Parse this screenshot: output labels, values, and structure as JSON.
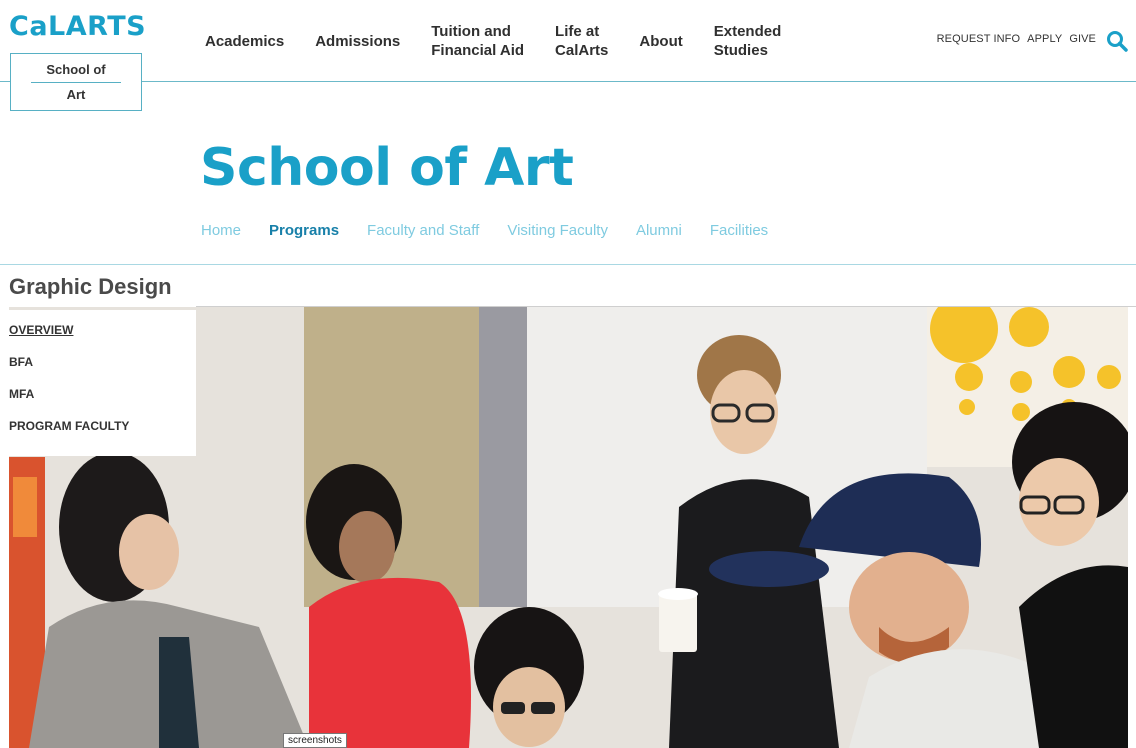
{
  "header": {
    "logo": "CaLARTS",
    "school_badge": {
      "line1": "School of",
      "line2": "Art"
    },
    "main_nav": [
      {
        "label": "Academics"
      },
      {
        "label": "Admissions"
      },
      {
        "label": "Tuition and\nFinancial Aid"
      },
      {
        "label": "Life at\nCalArts"
      },
      {
        "label": "About"
      },
      {
        "label": "Extended\nStudies"
      }
    ],
    "util_nav": [
      {
        "label": "REQUEST INFO"
      },
      {
        "label": "APPLY"
      },
      {
        "label": "GIVE"
      }
    ],
    "search_icon": "search-icon"
  },
  "page": {
    "title": "School of Art",
    "sub_nav": [
      {
        "label": "Home",
        "active": false
      },
      {
        "label": "Programs",
        "active": true
      },
      {
        "label": "Faculty and Staff",
        "active": false
      },
      {
        "label": "Visiting Faculty",
        "active": false
      },
      {
        "label": "Alumni",
        "active": false
      },
      {
        "label": "Facilities",
        "active": false
      }
    ]
  },
  "section": {
    "title": "Graphic Design",
    "menu": [
      {
        "label": "OVERVIEW",
        "current": true
      },
      {
        "label": "BFA",
        "current": false
      },
      {
        "label": "MFA",
        "current": false
      },
      {
        "label": "PROGRAM FACULTY",
        "current": false
      }
    ]
  },
  "tooltip": "screenshots",
  "colors": {
    "brand": "#1aa0c8",
    "subnav_active": "#1880a9",
    "subnav_inactive": "#7fcbe0",
    "rule": "#6cb9c9"
  }
}
